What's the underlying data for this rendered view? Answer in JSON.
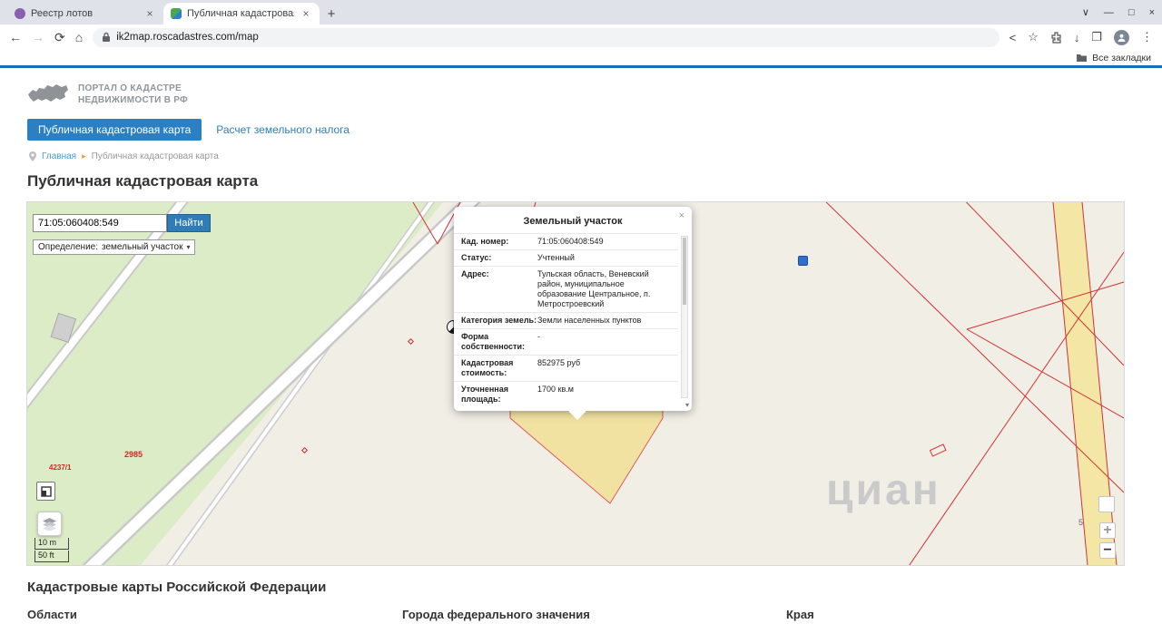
{
  "browser": {
    "tabs": [
      {
        "title": "Реестр лотов"
      },
      {
        "title": "Публичная кадастровая ка"
      }
    ],
    "url": "ik2map.roscadastres.com/map",
    "bookmarks_label": "Все закладки"
  },
  "site": {
    "logo_line1": "ПОРТАЛ О КАДАСТРЕ",
    "logo_line2": "НЕДВИЖИМОСТИ В РФ",
    "nav": {
      "tab_map": "Публичная кадастровая карта",
      "tab_tax": "Расчет земельного налога"
    },
    "breadcrumb": {
      "home": "Главная",
      "current": "Публичная кадастровая карта"
    },
    "page_title": "Публичная кадастровая карта"
  },
  "map": {
    "search_value": "71:05:060408:549",
    "search_button": "Найти",
    "filter_label": "Определение:",
    "filter_value": "земельный участок",
    "scale_m": "10 m",
    "scale_ft": "50 ft",
    "zoom_in": "+",
    "zoom_out": "−",
    "zoom_level": "5",
    "labels": {
      "parcel1": "2985",
      "parcel2": "4237/1"
    },
    "watermark": "циан"
  },
  "popup": {
    "title": "Земельный участок",
    "close": "×",
    "rows": [
      {
        "label": "Кад. номер:",
        "value": "71:05:060408:549"
      },
      {
        "label": "Статус:",
        "value": "Учтенный"
      },
      {
        "label": "Адрес:",
        "value": "Тульская область, Веневский район, муниципальное образование Центральное, п. Метростроевский"
      },
      {
        "label": "Категория земель:",
        "value": "Земли населенных пунктов"
      },
      {
        "label": "Форма собственности:",
        "value": "-"
      },
      {
        "label": "Кадастровая стоимость:",
        "value": "852975 руб"
      },
      {
        "label": "Уточненная площадь:",
        "value": "1700 кв.м"
      }
    ]
  },
  "footer": {
    "heading": "Кадастровые карты Российской Федерации",
    "columns": [
      "Области",
      "Города федерального значения",
      "Края"
    ]
  }
}
